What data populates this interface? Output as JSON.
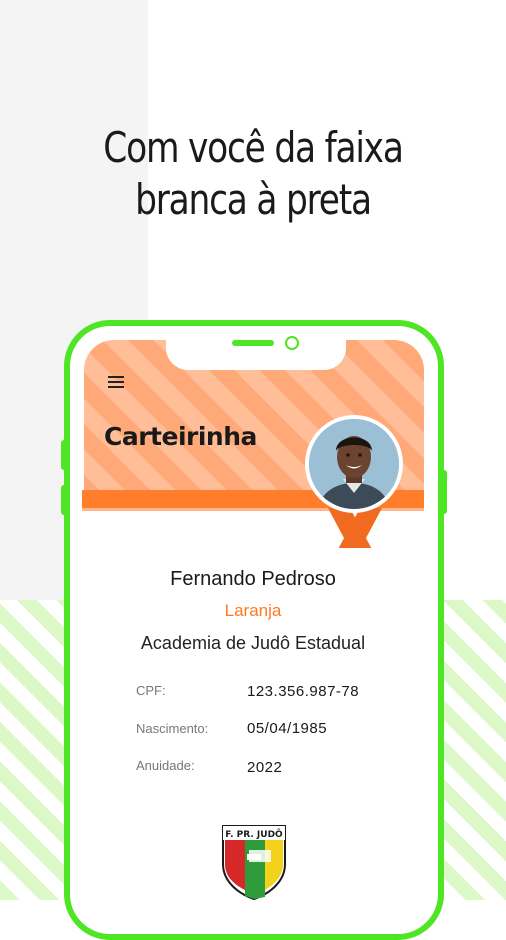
{
  "headline": {
    "line1": "Com você da faixa",
    "line2": "branca à preta"
  },
  "header": {
    "title": "Carteirinha",
    "menu_icon": "hamburger-menu-icon"
  },
  "profile": {
    "name": "Fernando Pedroso",
    "belt": "Laranja",
    "academy": "Academia de Judô Estadual"
  },
  "details": [
    {
      "label": "CPF:",
      "value": "123.356.987-78"
    },
    {
      "label": "Nascimento:",
      "value": "05/04/1985"
    },
    {
      "label": "Anuidade:",
      "value": "2022"
    }
  ],
  "logo": {
    "text": "F. PR. JUDÔ"
  },
  "colors": {
    "accent_green": "#4ee524",
    "belt_orange": "#ff7d2b",
    "header_orange": "#ffa979"
  }
}
